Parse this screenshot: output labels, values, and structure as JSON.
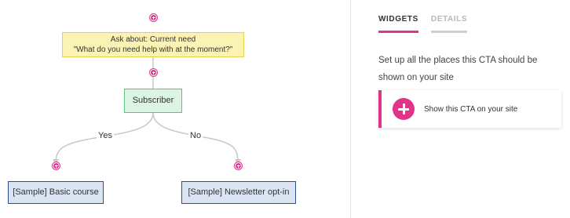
{
  "flow": {
    "question_node": {
      "line1": "Ask about: Current need",
      "line2": "\"What do you need help with at the moment?\""
    },
    "subscriber_node": {
      "label": "Subscriber"
    },
    "edges": {
      "yes_label": "Yes",
      "no_label": "No"
    },
    "outcomes": [
      {
        "label": "[Sample] Basic course"
      },
      {
        "label": "[Sample] Newsletter opt-in"
      }
    ]
  },
  "panel": {
    "tabs": [
      {
        "label": "WIDGETS",
        "active": true
      },
      {
        "label": "DETAILS",
        "active": false
      }
    ],
    "intro_text": "Set up all the places this CTA should be shown on your site",
    "cta_card": {
      "label": "Show this CTA on your site",
      "icon": "plus-icon"
    }
  },
  "colors": {
    "accent": "#e0338a",
    "question_fill": "#fbf3b3",
    "subscriber_fill": "#dcf5e2",
    "outcome_fill": "#dbe4f3"
  }
}
